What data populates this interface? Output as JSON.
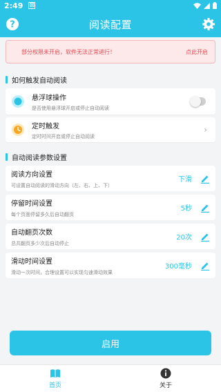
{
  "status_bar": {
    "time": "2:49",
    "notif_glyph": "⊠"
  },
  "app_bar": {
    "title": "阅读配置",
    "left_icon": "help-icon",
    "right_icon": "gear-icon"
  },
  "colors": {
    "accent": "#2cc4e6",
    "warning_text": "#e24a52",
    "warning_bg": "#fde9ea"
  },
  "warning": {
    "message": "部分权限未开启，软件无法正常进行！",
    "action": "点此开启"
  },
  "section1": {
    "title": "如何触发自动阅读",
    "floating": {
      "title": "悬浮球操作",
      "desc": "是否使用悬浮球开启或停止自动阅读",
      "toggle_on": false
    },
    "timer": {
      "title": "定时触发",
      "desc": "定时时间开启或停止自动阅读"
    }
  },
  "section2": {
    "title": "自动阅读参数设置",
    "items": [
      {
        "title": "阅读方向设置",
        "desc": "可设置自动阅读的滑动方向（左、右、上、下）",
        "value": "下滑"
      },
      {
        "title": "停留时间设置",
        "desc": "每个页面停留多久后自动翻页",
        "value": "5秒"
      },
      {
        "title": "自动翻页次数",
        "desc": "总共翻页多少次后自动停止",
        "value": "20次"
      },
      {
        "title": "滑动时间设置",
        "desc": "滑动一次时间，合理设置可以实现匀速滑动效果",
        "value": "300毫秒"
      }
    ]
  },
  "enable_button": "启用",
  "tabs": [
    {
      "label": "首页",
      "icon": "book-icon",
      "active": true
    },
    {
      "label": "关于",
      "icon": "info-icon",
      "active": false
    }
  ]
}
